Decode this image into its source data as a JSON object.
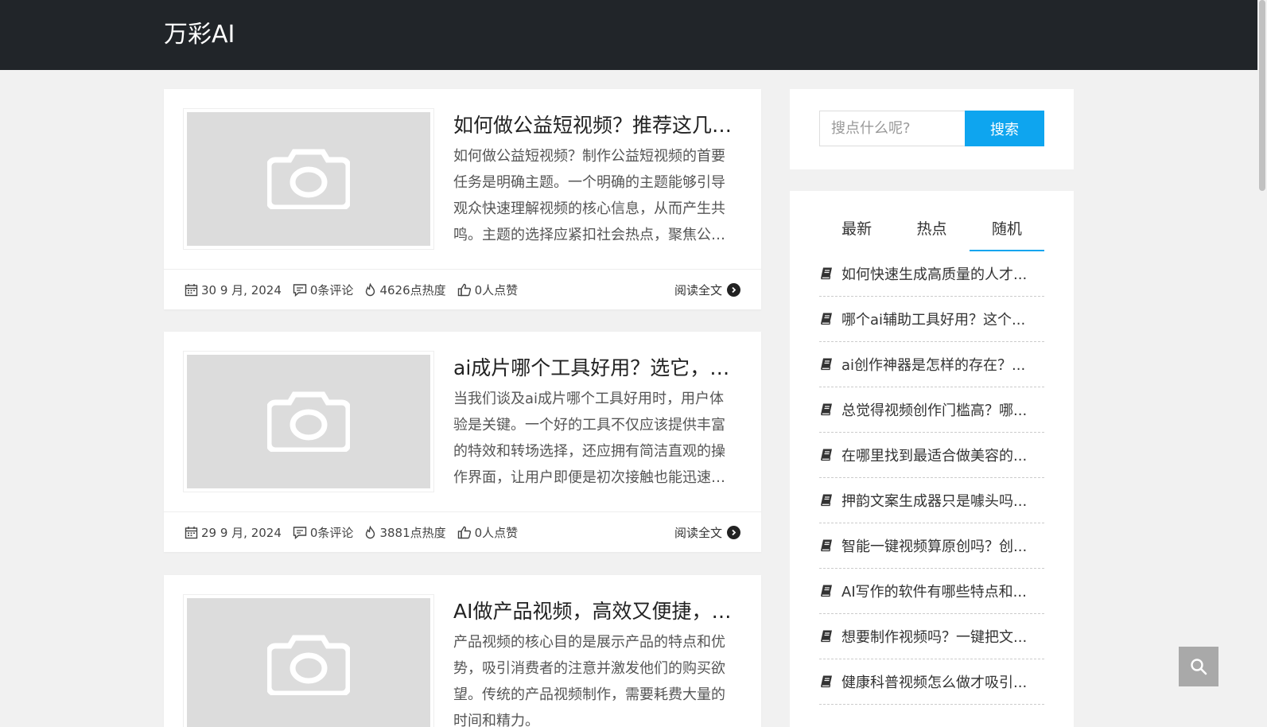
{
  "header": {
    "brand": "万彩AI"
  },
  "posts": [
    {
      "title": "如何做公益短视频？推荐这几个实用技巧",
      "excerpt": "如何做公益短视频？制作公益短视频的首要任务是明确主题。一个明确的主题能够引导观众快速理解视频的核心信息，从而产生共鸣。主题的选择应紧扣社会热点，聚焦公益话题。",
      "date": "30 9 月, 2024",
      "comments": "0条评论",
      "heat": "4626点热度",
      "likes": "0人点赞",
      "read_more": "阅读全文"
    },
    {
      "title": "ai成片哪个工具好用？选它，效率翻倍",
      "excerpt": "当我们谈及ai成片哪个工具好用时，用户体验是关键。一个好的工具不仅应该提供丰富的特效和转场选择，还应拥有简洁直观的操作界面，让用户即便是初次接触也能迅速上手。",
      "date": "29 9 月, 2024",
      "comments": "0条评论",
      "heat": "3881点热度",
      "likes": "0人点赞",
      "read_more": "阅读全文"
    },
    {
      "title": "AI做产品视频，高效又便捷，快来试试",
      "excerpt": "产品视频的核心目的是展示产品的特点和优势，吸引消费者的注意并激发他们的购买欲望。传统的产品视频制作，需要耗费大量的时间和精力。",
      "date": "",
      "comments": "",
      "heat": "",
      "likes": "",
      "read_more": ""
    }
  ],
  "sidebar": {
    "search": {
      "placeholder": "搜点什么呢?",
      "button": "搜索"
    },
    "tabs": [
      "最新",
      "热点",
      "随机"
    ],
    "active_tab": 2,
    "items": [
      "如何快速生成高质量的人才...",
      "哪个ai辅助工具好用？这个...",
      "ai创作神器是怎样的存在？...",
      "总觉得视频创作门槛高？哪...",
      "在哪里找到最适合做美容的...",
      "押韵文案生成器只是噱头吗...",
      "智能一键视频算原创吗？创...",
      "AI写作的软件有哪些特点和...",
      "想要制作视频吗？一键把文...",
      "健康科普视频怎么做才吸引..."
    ]
  },
  "colors": {
    "header_bg": "#212529",
    "accent": "#0ea5ef",
    "page_bg": "#f1f1f1"
  }
}
